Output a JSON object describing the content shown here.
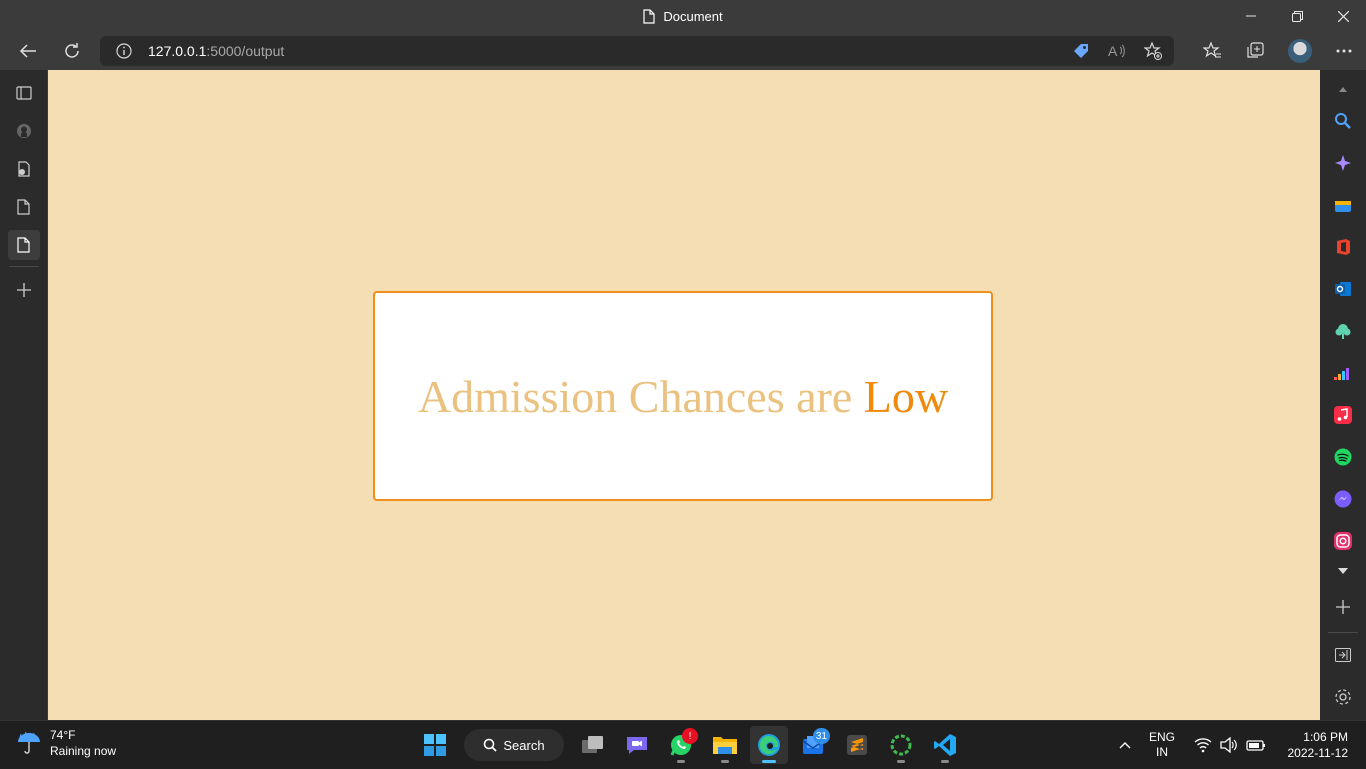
{
  "window": {
    "title": "Document"
  },
  "address": {
    "host": "127.0.0.1",
    "path": ":5000/output"
  },
  "result": {
    "prefix": "Admission Chances are ",
    "level": "Low"
  },
  "weather": {
    "temp": "74°F",
    "condition": "Raining now"
  },
  "taskbar": {
    "search_label": "Search",
    "mail_badge": "31",
    "whatsapp_badge": "!"
  },
  "tray": {
    "lang_top": "ENG",
    "lang_bottom": "IN",
    "time": "1:06 PM",
    "date": "2022-11-12"
  },
  "colors": {
    "page_bg": "#f5deb3",
    "box_border": "#f0901a",
    "text_light": "#ebc17f",
    "text_accent": "#f08a0a"
  },
  "icons": {
    "toolbar": [
      "back-icon",
      "refresh-icon",
      "info-icon",
      "coupon-icon",
      "read-aloud-icon",
      "add-favorite-icon",
      "favorites-icon",
      "collections-icon",
      "profile-avatar",
      "more-icon"
    ],
    "left_sidebar": [
      "tab-actions-icon",
      "github-icon",
      "file-settings-icon",
      "page-icon",
      "page-icon-active",
      "add-icon"
    ],
    "right_sidebar": [
      "search-icon",
      "copilot-icon",
      "shopping-icon",
      "office-icon",
      "outlook-icon",
      "tree-icon",
      "deezer-icon",
      "apple-music-icon",
      "spotify-icon",
      "messenger-icon",
      "instagram-icon",
      "collapse-icon",
      "add-icon",
      "split-screen-icon",
      "settings-icon"
    ]
  }
}
